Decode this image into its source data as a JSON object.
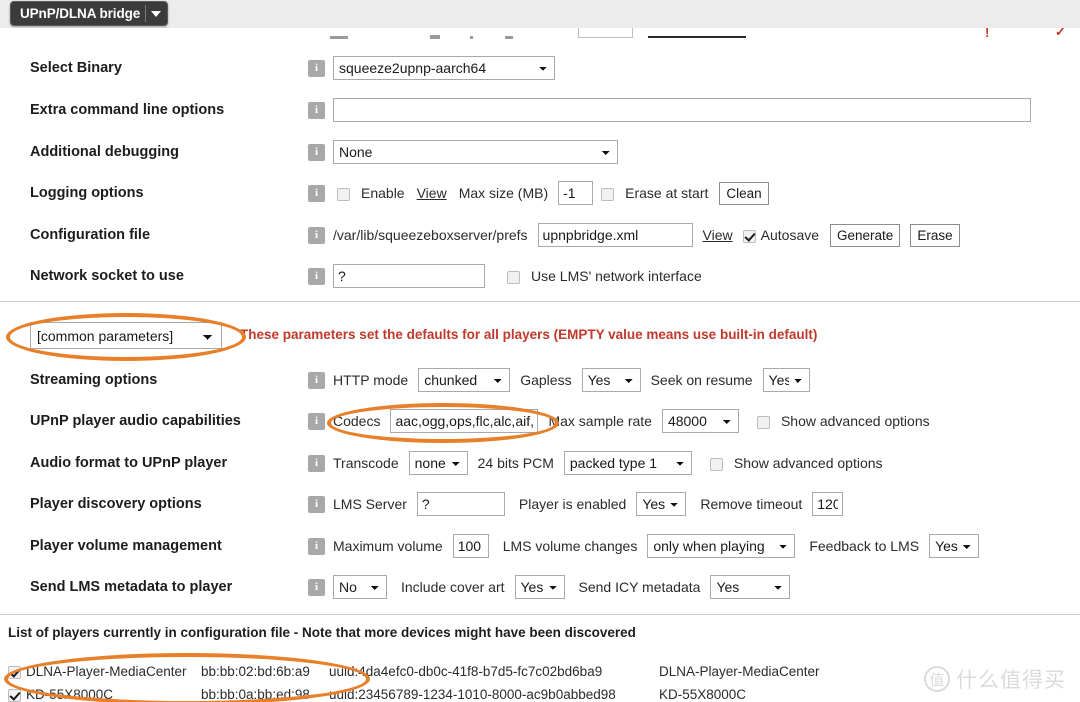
{
  "browser": {
    "tab_title": "UPnP/DLNA bridge",
    "tab_caret_icon": "chevron-down-icon"
  },
  "settings_rows": [
    {
      "label": "Select Binary",
      "info_icon": "info-icon",
      "binary_select": "squeeze2upnp-aarch64"
    },
    {
      "label": "Extra command line options",
      "info_icon": "info-icon",
      "extra_options_value": "",
      "extra_options_placeholder": ""
    },
    {
      "label": "Additional debugging",
      "info_icon": "info-icon",
      "debug_select": "None"
    },
    {
      "label": "Logging options",
      "info_icon": "info-icon",
      "enable_label": "Enable",
      "view_link": "View",
      "max_size_label": "Max size (MB)",
      "max_size_value": "-1",
      "erase_at_start_label": "Erase at start",
      "clean_button": "Clean"
    },
    {
      "label": "Configuration file",
      "info_icon": "info-icon",
      "path_text": "/var/lib/squeezeboxserver/prefs",
      "filename_value": "upnpbridge.xml",
      "view_link": "View",
      "autosave_label": "Autosave",
      "generate_button": "Generate",
      "erase_button": "Erase"
    },
    {
      "label": "Network socket to use",
      "info_icon": "info-icon",
      "socket_value": "?",
      "use_lms_interface_label": "Use LMS' network interface"
    }
  ],
  "common": {
    "scope_select": "[common parameters]",
    "note": "These parameters set the defaults for all players (EMPTY value means use built-in default)",
    "note_color": "#c0392b"
  },
  "player_rows": [
    {
      "label": "Streaming options",
      "info_icon": "info-icon",
      "http_mode_label": "HTTP mode",
      "http_mode_value": "chunked",
      "gapless_label": "Gapless",
      "gapless_value": "Yes",
      "seek_label": "Seek on resume",
      "seek_value": "Yes"
    },
    {
      "label": "UPnP player audio capabilities",
      "info_icon": "info-icon",
      "codecs_label": "Codecs",
      "codecs_value": "aac,ogg,ops,flc,alc,aif,pc",
      "max_rate_label": "Max sample rate",
      "max_rate_value": "48000",
      "advanced_label": "Show advanced options"
    },
    {
      "label": "Audio format to UPnP player",
      "info_icon": "info-icon",
      "transcode_label": "Transcode",
      "transcode_value": "none",
      "pcm_label": "24 bits PCM",
      "pcm_value": "packed type 1",
      "advanced_label": "Show advanced options"
    },
    {
      "label": "Player discovery options",
      "info_icon": "info-icon",
      "lms_server_label": "LMS Server",
      "lms_server_value": "?",
      "player_enabled_label": "Player is enabled",
      "player_enabled_value": "Yes",
      "remove_timeout_label": "Remove timeout",
      "remove_timeout_value": "120"
    },
    {
      "label": "Player volume management",
      "info_icon": "info-icon",
      "max_volume_label": "Maximum volume",
      "max_volume_value": "100",
      "lms_volume_label": "LMS volume changes",
      "lms_volume_value": "only when playing",
      "feedback_label": "Feedback to LMS",
      "feedback_value": "Yes"
    },
    {
      "label": "Send LMS metadata to player",
      "info_icon": "info-icon",
      "metadata_value": "No",
      "cover_art_label": "Include cover art",
      "cover_art_value": "Yes",
      "icy_label": "Send ICY metadata",
      "icy_value": "Yes"
    }
  ],
  "players": {
    "header": "List of players currently in configuration file - Note that more devices might have been discovered",
    "rows": [
      {
        "enabled": true,
        "name": "DLNA-Player-MediaCenter",
        "mac": "bb:bb:02:bd:6b:a9",
        "uuid": "uuid:4da4efc0-db0c-41f8-b7d5-fc7c02bd6ba9",
        "display_name": "DLNA-Player-MediaCenter"
      },
      {
        "enabled": true,
        "name": "KD-55X8000C",
        "mac": "bb:bb:0a:bb:ed:98",
        "uuid": "uuid:23456789-1234-1010-8000-ac9b0abbed98",
        "display_name": "KD-55X8000C"
      }
    ]
  },
  "annotations": {
    "marker_color": "#e8802a",
    "highlights": [
      "scope-select-ellipse",
      "codecs-field-ellipse",
      "first-player-row-ellipse"
    ]
  },
  "watermark": {
    "badge": "值",
    "text": "什么值得买"
  }
}
